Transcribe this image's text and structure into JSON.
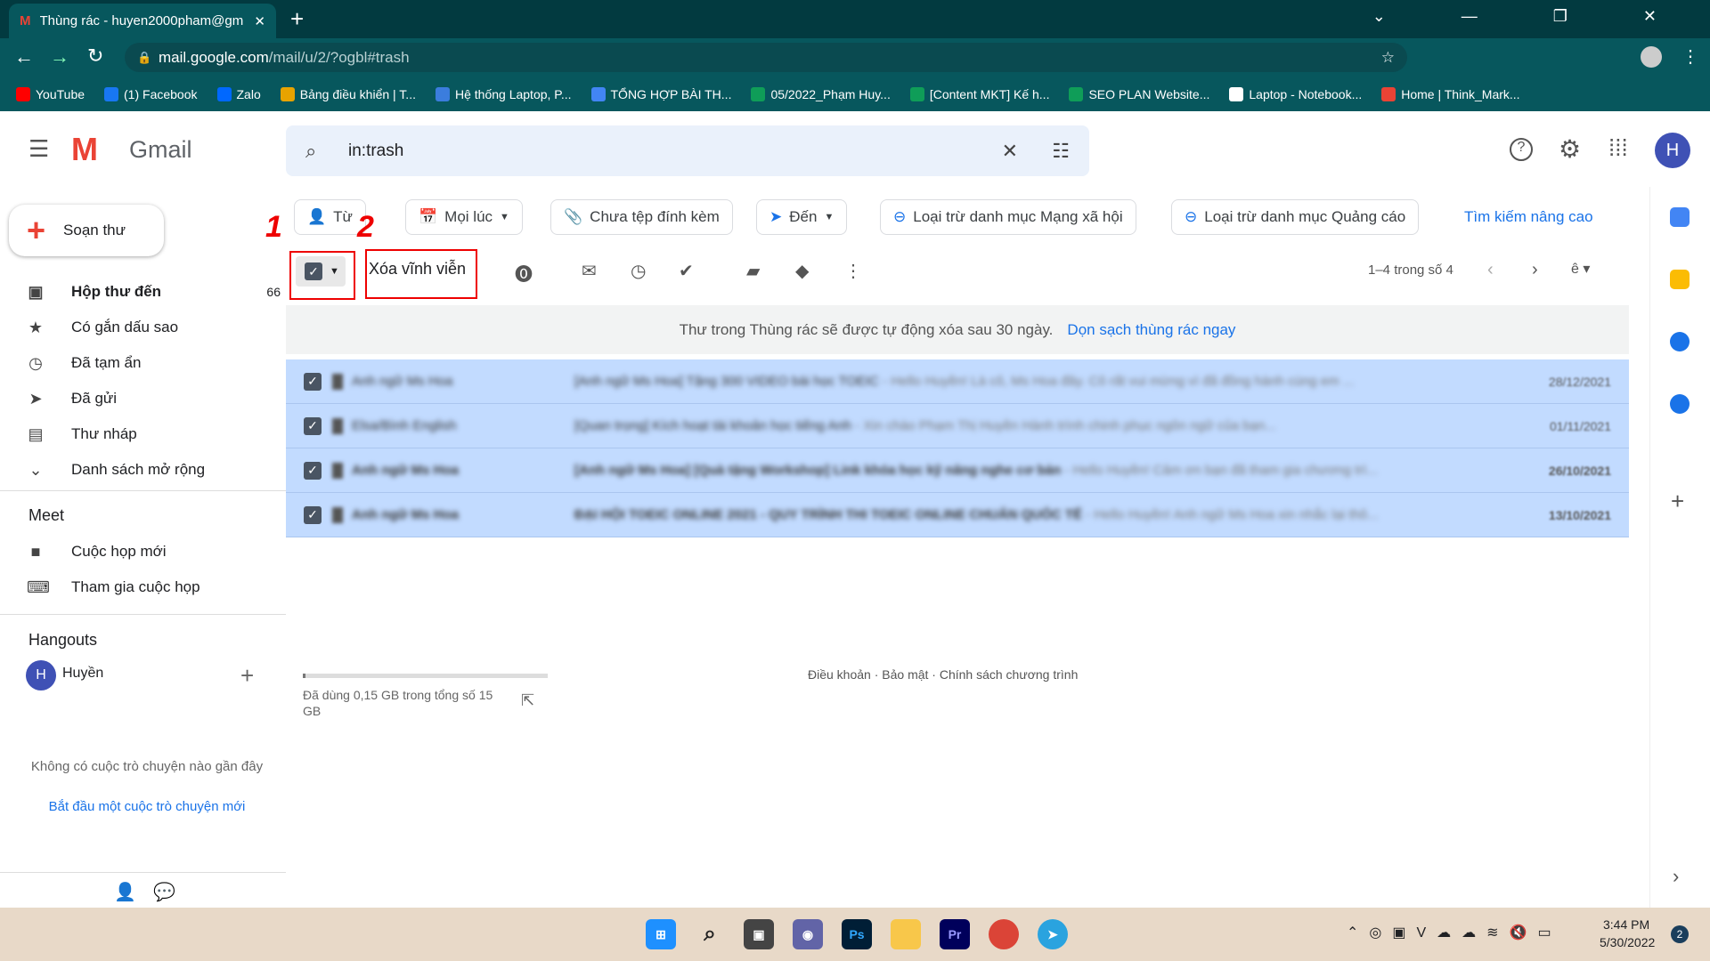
{
  "browser": {
    "tab_title": "Thùng rác - huyen2000pham@gm",
    "url_host": "mail.google.com",
    "url_path": "/mail/u/2/?ogbl#trash",
    "bookmarks": [
      "YouTube",
      "(1) Facebook",
      "Zalo",
      "Bảng điều khiển | T...",
      "Hệ thống Laptop, P...",
      "TỔNG HỢP BÀI TH...",
      "05/2022_Phạm Huy...",
      "[Content MKT] Kế h...",
      "SEO PLAN Website...",
      "Laptop - Notebook...",
      "Home | Think_Mark..."
    ],
    "bookmark_colors": [
      "#ff0000",
      "#1877f2",
      "#0068ff",
      "#e8a300",
      "#3b7ddd",
      "#4285f4",
      "#0f9d58",
      "#0f9d58",
      "#0f9d58",
      "#ffffff",
      "#ea4335"
    ]
  },
  "header": {
    "app_name": "Gmail",
    "search_value": "in:trash",
    "avatar_letter": "H"
  },
  "compose": "Soạn thư",
  "nav": [
    {
      "label": "Hộp thư đến",
      "count": "66",
      "icon": "inbox-icon",
      "glyph": "▣"
    },
    {
      "label": "Có gắn dấu sao",
      "icon": "star-icon",
      "glyph": "★"
    },
    {
      "label": "Đã tạm ẩn",
      "icon": "clock-icon",
      "glyph": "◷"
    },
    {
      "label": "Đã gửi",
      "icon": "send-icon",
      "glyph": "➤"
    },
    {
      "label": "Thư nháp",
      "icon": "draft-icon",
      "glyph": "▤"
    },
    {
      "label": "Danh sách mở rộng",
      "icon": "chevron-down-icon",
      "glyph": "⌄"
    }
  ],
  "meet": {
    "title": "Meet",
    "items": [
      "Cuộc họp mới",
      "Tham gia cuộc họp"
    ]
  },
  "hangouts": {
    "title": "Hangouts",
    "user": "Huyền",
    "empty": "Không có cuộc trò chuyện nào gần đây",
    "start": "Bắt đầu một cuộc trò chuyện mới"
  },
  "filters": [
    "Từ",
    "Mọi lúc",
    "Chưa tệp đính kèm",
    "Đến",
    "Loại trừ danh mục Mạng xã hội",
    "Loại trừ danh mục Quảng cáo"
  ],
  "advanced_search": "Tìm kiếm nâng cao",
  "toolbar": {
    "delete_forever": "Xóa vĩnh viễn",
    "pagination": "1–4 trong số 4"
  },
  "annotations": [
    "1",
    "2"
  ],
  "banner": {
    "text": "Thư trong Thùng rác sẽ được tự động xóa sau 30 ngày.",
    "link": "Dọn sạch thùng rác ngay"
  },
  "emails": [
    {
      "sender": "Anh ngữ Ms Hoa",
      "subject": "[Anh ngữ Ms Hoa] Tặng 300 VIDEO bài học TOEIC",
      "snippet": " - Hello Huyền! Là cô, Ms Hoa đây. Cô rất vui mừng vì đã đồng hành cùng em ...",
      "date": "28/12/2021",
      "unread": false
    },
    {
      "sender": "Elsa/Bình English",
      "subject": "[Quan trọng] Kích hoạt tài khoản học tiếng Anh",
      "snippet": " - Xin chào Phạm Thị Huyền Hành trình chinh phục ngôn ngữ của bạn...",
      "date": "01/11/2021",
      "unread": false
    },
    {
      "sender": "Anh ngữ Ms Hoa",
      "subject": "[Anh ngữ Ms Hoa] [Quà tặng Workshop] Link khóa học kỹ năng nghe cơ bản",
      "snippet": " - Hello Huyền! Cảm ơn bạn đã tham gia chương trì...",
      "date": "26/10/2021",
      "unread": true
    },
    {
      "sender": "Anh ngữ Ms Hoa",
      "subject": "ĐẠI HỘI TOEIC ONLINE 2021 - QUY TRÌNH THI TOEIC ONLINE CHUẨN QUỐC TẾ",
      "snippet": " - Hello Huyền! Anh ngữ Ms Hoa xin nhắc lại thô...",
      "date": "13/10/2021",
      "unread": true
    }
  ],
  "storage": {
    "text": "Đã dùng 0,15 GB trong tổng số 15 GB",
    "used_fraction": 0.01
  },
  "footer": "Điều khoản · Bảo mật · Chính sách chương trình",
  "taskbar": {
    "time": "3:44 PM",
    "date": "5/30/2022",
    "notifications": "2"
  },
  "colors": {
    "accent": "#1a73e8",
    "selected_row": "#c2dbff",
    "annotation": "#e00000"
  }
}
